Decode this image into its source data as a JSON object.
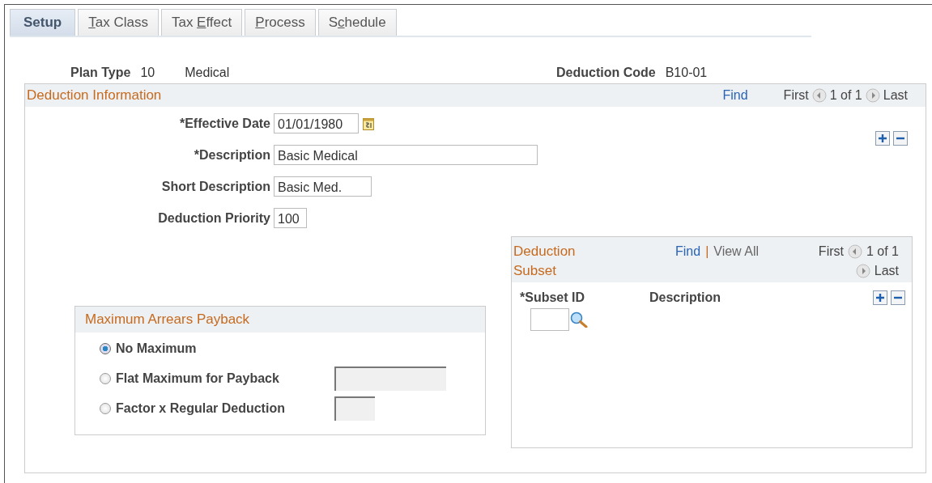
{
  "tabs": [
    {
      "label_parts": [
        {
          "text": "Setup",
          "underlined": false
        }
      ],
      "selected": true
    },
    {
      "label_parts": [
        {
          "text": "T",
          "underlined": true
        },
        {
          "text": "ax Class",
          "underlined": false
        }
      ],
      "selected": false
    },
    {
      "label_parts": [
        {
          "text": "Tax ",
          "underlined": false
        },
        {
          "text": "E",
          "underlined": true
        },
        {
          "text": "ffect",
          "underlined": false
        }
      ],
      "selected": false
    },
    {
      "label_parts": [
        {
          "text": "P",
          "underlined": true
        },
        {
          "text": "rocess",
          "underlined": false
        }
      ],
      "selected": false
    },
    {
      "label_parts": [
        {
          "text": "S",
          "underlined": false
        },
        {
          "text": "c",
          "underlined": true
        },
        {
          "text": "hedule",
          "underlined": false
        }
      ],
      "selected": false
    }
  ],
  "header": {
    "plan_type_label": "Plan Type",
    "plan_type": "10",
    "plan_name": "Medical",
    "deduction_code_label": "Deduction Code",
    "deduction_code": "B10-01"
  },
  "deduction_information": {
    "title": "Deduction Information",
    "find": "Find",
    "first": "First",
    "count": "1 of 1",
    "last": "Last",
    "fields": [
      {
        "label": "*Effective Date",
        "value": "01/01/1980",
        "kind": "date"
      },
      {
        "label": "*Description",
        "value": "Basic Medical",
        "kind": "wide"
      },
      {
        "label": "Short Description",
        "value": "Basic Med.",
        "kind": "medium"
      },
      {
        "label": "Deduction Priority",
        "value": "100",
        "kind": "short"
      }
    ]
  },
  "maximum_arrears_payback": {
    "title": "Maximum Arrears Payback",
    "options": [
      {
        "label": "No Maximum",
        "selected": true,
        "kind": "plain"
      },
      {
        "label": "Flat Maximum for Payback",
        "selected": false,
        "kind": "wide_field"
      },
      {
        "label": "Factor x Regular Deduction",
        "selected": false,
        "kind": "short_field"
      }
    ]
  },
  "deduction_subset": {
    "title": "Deduction Subset",
    "find": "Find",
    "separator": "|",
    "view_all": "View All",
    "first": "First",
    "count": "1 of 1",
    "last": "Last",
    "columns": [
      "*Subset ID",
      "Description"
    ]
  }
}
